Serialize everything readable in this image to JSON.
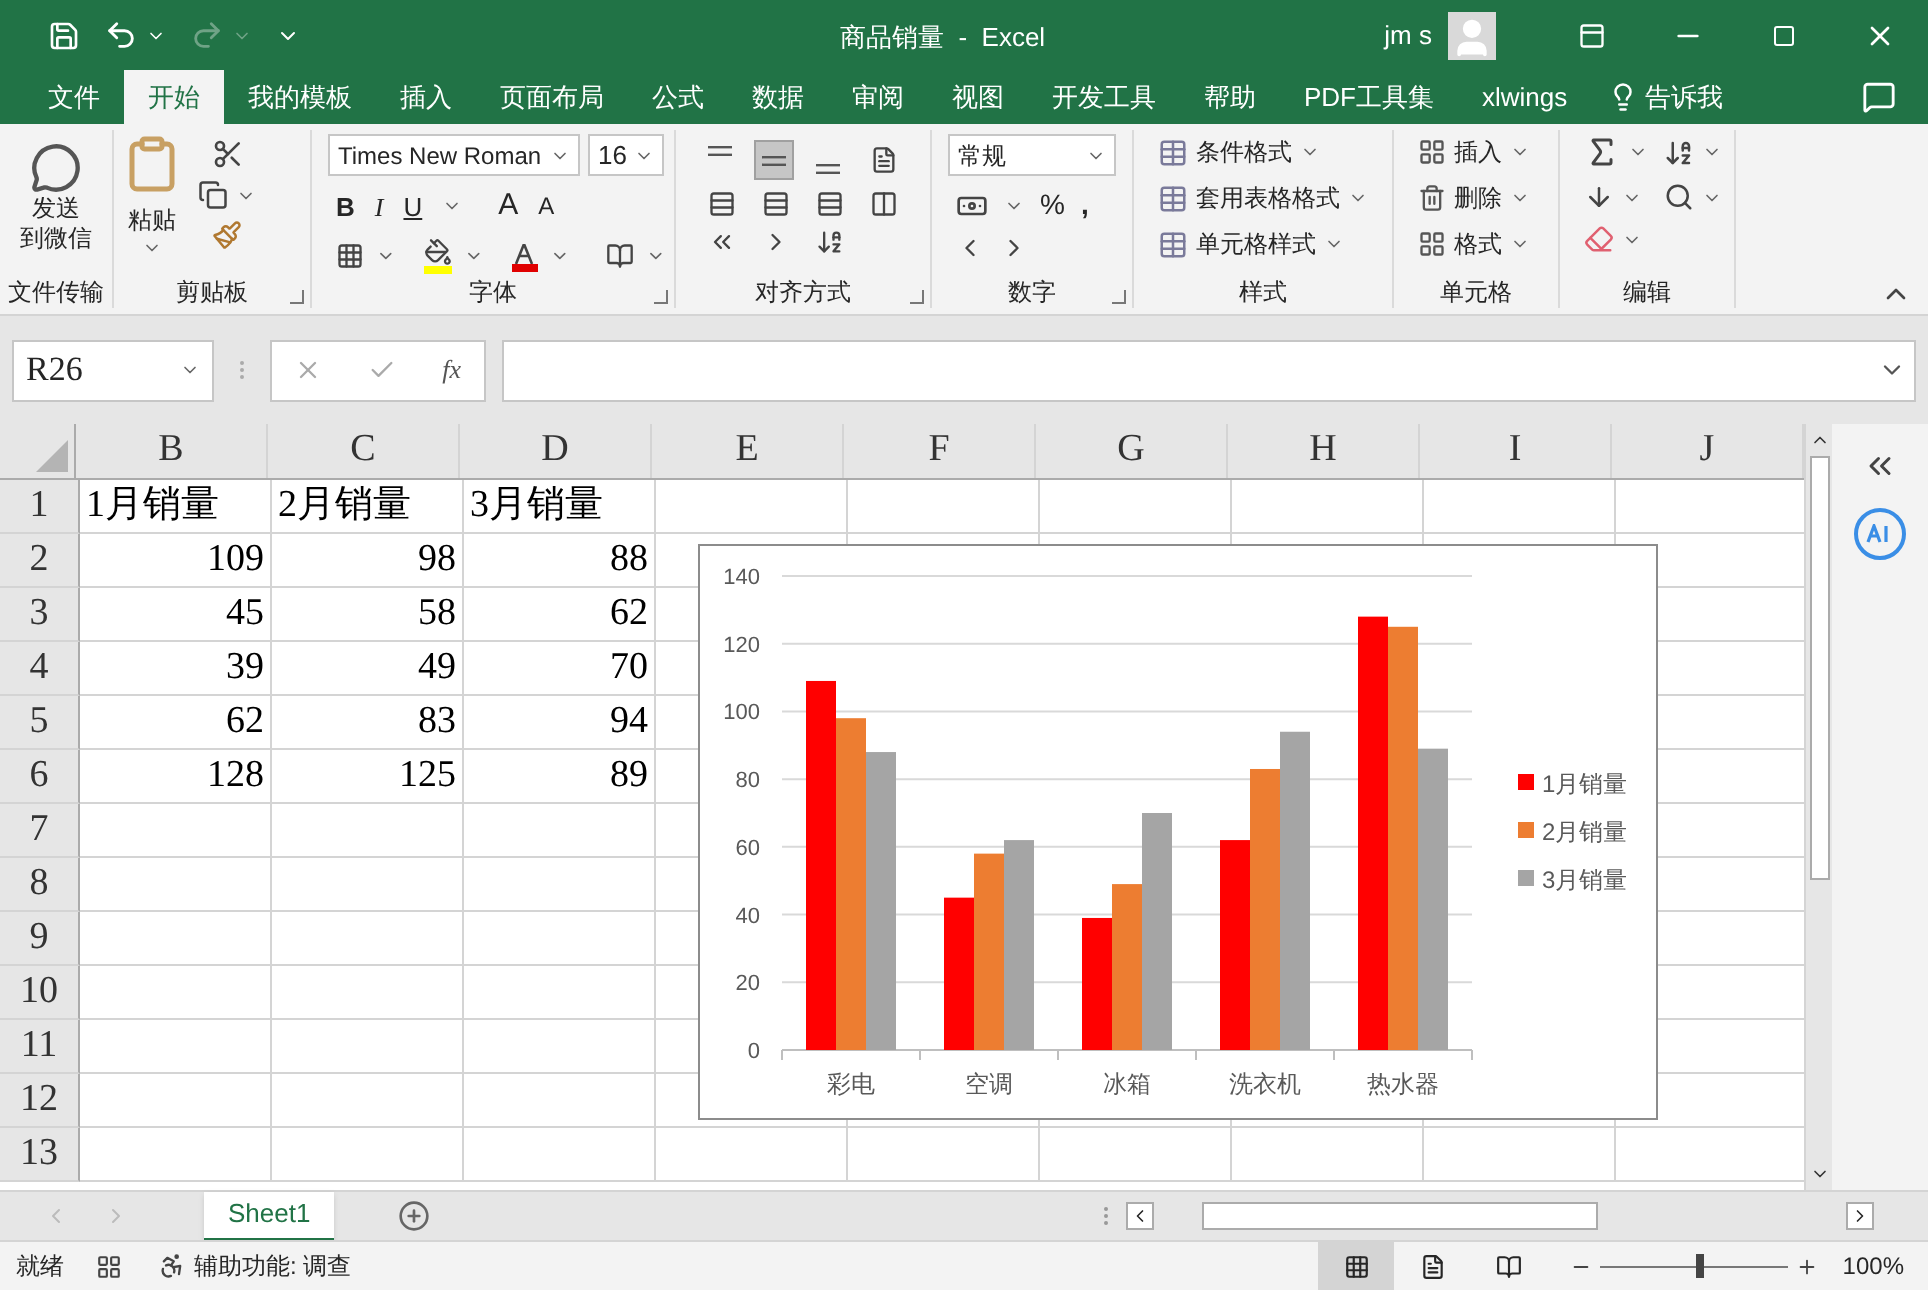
{
  "title_bar": {
    "title": "商品销量  -  Excel",
    "user": "jm s",
    "redo": {
      "disabled": true
    }
  },
  "ribbon_tabs": [
    {
      "label": "文件",
      "selected": false
    },
    {
      "label": "开始",
      "selected": true
    },
    {
      "label": "我的模板",
      "selected": false
    },
    {
      "label": "插入",
      "selected": false
    },
    {
      "label": "页面布局",
      "selected": false
    },
    {
      "label": "公式",
      "selected": false
    },
    {
      "label": "数据",
      "selected": false
    },
    {
      "label": "审阅",
      "selected": false
    },
    {
      "label": "视图",
      "selected": false
    },
    {
      "label": "开发工具",
      "selected": false
    },
    {
      "label": "帮助",
      "selected": false
    },
    {
      "label": "PDF工具集",
      "selected": false
    },
    {
      "label": "xlwings",
      "selected": false
    }
  ],
  "tell_me": "告诉我",
  "ribbon": {
    "groups": [
      "文件传输",
      "剪贴板",
      "字体",
      "对齐方式",
      "数字",
      "样式",
      "单元格",
      "编辑"
    ],
    "send_to_wechat": [
      "发送",
      "到微信"
    ],
    "paste": "粘贴",
    "font_name": "Times New Roman",
    "font_size": "16",
    "bold": "B",
    "italic": "I",
    "underline": "U",
    "grow_font": "A",
    "shrink_font": "A",
    "vertical_align": [
      {
        "selected": false
      },
      {
        "selected": true
      },
      {
        "selected": false
      }
    ],
    "number_format": "常规",
    "percent": "%",
    "comma": ",",
    "styles": [
      "条件格式",
      "套用表格格式",
      "单元格样式"
    ],
    "cells": [
      "插入",
      "删除",
      "格式"
    ]
  },
  "formula_bar": {
    "name_box": "R26",
    "function_button": "fx"
  },
  "sheet": {
    "columns": [
      "B",
      "C",
      "D",
      "E",
      "F",
      "G",
      "H",
      "I",
      "J"
    ],
    "rows": [
      {
        "header": "1",
        "kind": "text",
        "cells": [
          "1月销量",
          "2月销量",
          "3月销量"
        ]
      },
      {
        "header": "2",
        "kind": "number",
        "cells": [
          "109",
          "98",
          "88"
        ]
      },
      {
        "header": "3",
        "kind": "number",
        "cells": [
          "45",
          "58",
          "62"
        ]
      },
      {
        "header": "4",
        "kind": "number",
        "cells": [
          "39",
          "49",
          "70"
        ]
      },
      {
        "header": "5",
        "kind": "number",
        "cells": [
          "62",
          "83",
          "94"
        ]
      },
      {
        "header": "6",
        "kind": "number",
        "cells": [
          "128",
          "125",
          "89"
        ]
      },
      {
        "header": "7"
      },
      {
        "header": "8"
      },
      {
        "header": "9"
      },
      {
        "header": "10"
      },
      {
        "header": "11"
      },
      {
        "header": "12"
      },
      {
        "header": "13"
      }
    ],
    "chart": {
      "chart_data": {
        "type": "bar",
        "categories": [
          "彩电",
          "空调",
          "冰箱",
          "洗衣机",
          "热水器"
        ],
        "series": [
          {
            "name": "1月销量",
            "color": "#ff0000",
            "values": [
              109,
              45,
              39,
              62,
              128
            ]
          },
          {
            "name": "2月销量",
            "color": "#ed7d31",
            "values": [
              98,
              58,
              49,
              83,
              125
            ]
          },
          {
            "name": "3月销量",
            "color": "#a5a5a5",
            "values": [
              88,
              62,
              70,
              94,
              89
            ]
          }
        ],
        "grid": true,
        "legend": true,
        "ylim": [
          0,
          140
        ],
        "yticks": [
          0,
          20,
          40,
          60,
          80,
          100,
          120,
          140
        ]
      }
    }
  },
  "sheet_tabs": [
    {
      "label": "Sheet1",
      "selected": true
    }
  ],
  "status_bar": {
    "ready": "就绪",
    "accessibility": "辅助功能: 调查",
    "views": [
      {
        "selected": true
      },
      {
        "selected": false
      },
      {
        "selected": false
      }
    ],
    "zoom": {
      "level": 0.53,
      "reading": "100%"
    }
  }
}
